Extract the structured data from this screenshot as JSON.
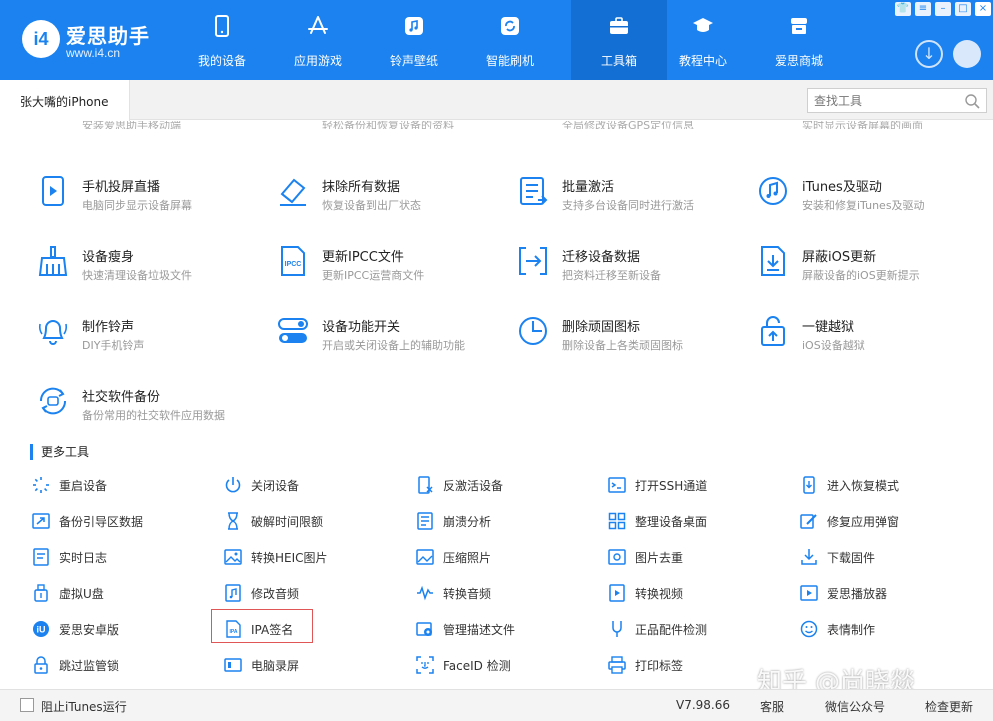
{
  "app": {
    "logo_badge": "i4",
    "logo_name": "爱思助手",
    "logo_url": "www.i4.cn",
    "brand_color": "#1b82ef"
  },
  "nav": [
    {
      "label": "我的设备",
      "icon": "phone-icon"
    },
    {
      "label": "应用游戏",
      "icon": "appstore-icon"
    },
    {
      "label": "铃声壁纸",
      "icon": "music-icon"
    },
    {
      "label": "智能刷机",
      "icon": "refresh-icon"
    },
    {
      "label": "工具箱",
      "icon": "toolbox-icon",
      "active": true
    },
    {
      "label": "教程中心",
      "icon": "graduation-cap-icon"
    },
    {
      "label": "爱思商城",
      "icon": "store-icon"
    }
  ],
  "window_buttons": [
    "shirt-icon",
    "menu-icon",
    "minimize-icon",
    "maximize-icon",
    "close-icon"
  ],
  "device_tab": "张大嘴的iPhone",
  "search": {
    "placeholder": "查找工具"
  },
  "cutoff_row": [
    "安装爱思助手移动端",
    "轻松备份和恢复设备的资料",
    "全局修改设备GPS定位信息",
    "实时显示设备屏幕的画面"
  ],
  "tools": [
    {
      "title": "手机投屏直播",
      "desc": "电脑同步显示设备屏幕",
      "icon": "screen-mirror-icon"
    },
    {
      "title": "抹除所有数据",
      "desc": "恢复设备到出厂状态",
      "icon": "eraser-icon"
    },
    {
      "title": "批量激活",
      "desc": "支持多台设备同时进行激活",
      "icon": "batch-activate-icon"
    },
    {
      "title": "iTunes及驱动",
      "desc": "安装和修复iTunes及驱动",
      "icon": "itunes-icon"
    },
    {
      "title": "设备瘦身",
      "desc": "快速清理设备垃圾文件",
      "icon": "broom-icon"
    },
    {
      "title": "更新IPCC文件",
      "desc": "更新IPCC运营商文件",
      "icon": "ipcc-file-icon"
    },
    {
      "title": "迁移设备数据",
      "desc": "把资料迁移至新设备",
      "icon": "migrate-icon"
    },
    {
      "title": "屏蔽iOS更新",
      "desc": "屏蔽设备的iOS更新提示",
      "icon": "block-update-icon"
    },
    {
      "title": "制作铃声",
      "desc": "DIY手机铃声",
      "icon": "bell-icon"
    },
    {
      "title": "设备功能开关",
      "desc": "开启或关闭设备上的辅助功能",
      "icon": "toggle-icon"
    },
    {
      "title": "删除顽固图标",
      "desc": "删除设备上各类顽固图标",
      "icon": "pie-clock-icon"
    },
    {
      "title": "一键越狱",
      "desc": "iOS设备越狱",
      "icon": "unlock-upload-icon"
    },
    {
      "title": "社交软件备份",
      "desc": "备份常用的社交软件应用数据",
      "icon": "social-backup-icon"
    }
  ],
  "more_tools_title": "更多工具",
  "more_tools": [
    {
      "label": "重启设备",
      "icon": "restart-spinner-icon"
    },
    {
      "label": "关闭设备",
      "icon": "power-icon"
    },
    {
      "label": "反激活设备",
      "icon": "deactivate-icon"
    },
    {
      "label": "打开SSH通道",
      "icon": "terminal-icon"
    },
    {
      "label": "进入恢复模式",
      "icon": "recovery-mode-icon"
    },
    {
      "label": "备份引导区数据",
      "icon": "backup-boot-icon"
    },
    {
      "label": "破解时间限额",
      "icon": "hourglass-icon"
    },
    {
      "label": "崩溃分析",
      "icon": "crash-list-icon"
    },
    {
      "label": "整理设备桌面",
      "icon": "grid-icon"
    },
    {
      "label": "修复应用弹窗",
      "icon": "repair-popup-icon"
    },
    {
      "label": "实时日志",
      "icon": "log-icon"
    },
    {
      "label": "转换HEIC图片",
      "icon": "heic-image-icon"
    },
    {
      "label": "压缩照片",
      "icon": "compress-photo-icon"
    },
    {
      "label": "图片去重",
      "icon": "dedupe-image-icon"
    },
    {
      "label": "下载固件",
      "icon": "download-firmware-icon"
    },
    {
      "label": "虚拟U盘",
      "icon": "usb-drive-icon"
    },
    {
      "label": "修改音频",
      "icon": "edit-audio-icon"
    },
    {
      "label": "转换音频",
      "icon": "audio-wave-icon"
    },
    {
      "label": "转换视频",
      "icon": "convert-video-icon"
    },
    {
      "label": "爱思播放器",
      "icon": "player-icon"
    },
    {
      "label": "爱思安卓版",
      "icon": "i4-android-icon"
    },
    {
      "label": "IPA签名",
      "icon": "ipa-file-icon",
      "highlighted": true
    },
    {
      "label": "管理描述文件",
      "icon": "profile-gear-icon"
    },
    {
      "label": "正品配件检测",
      "icon": "accessory-check-icon"
    },
    {
      "label": "表情制作",
      "icon": "smiley-icon"
    },
    {
      "label": "跳过监管锁",
      "icon": "lock-icon"
    },
    {
      "label": "电脑录屏",
      "icon": "screen-record-icon"
    },
    {
      "label": "FaceID 检测",
      "icon": "faceid-icon"
    },
    {
      "label": "打印标签",
      "icon": "printer-icon"
    }
  ],
  "highlight_color": "#e05555",
  "footer": {
    "itunes_checkbox_label": "阻止iTunes运行",
    "itunes_checked": false,
    "version": "V7.98.66",
    "support": "客服",
    "wechat": "微信公众号",
    "check_update": "检查更新"
  },
  "watermark": "知乎 @尚晓燚"
}
